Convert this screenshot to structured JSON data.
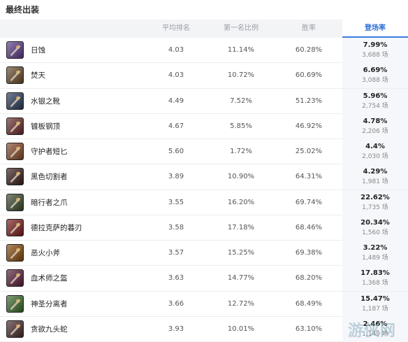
{
  "title": "最终出装",
  "header": {
    "avg_rank": "平均排名",
    "first_ratio": "第一名比例",
    "win_rate": "胜率",
    "pick_rate": "登场率"
  },
  "items": [
    {
      "name": "日蚀",
      "avg_rank": "4.03",
      "first_ratio": "11.14%",
      "win_rate": "60.28%",
      "pick_rate": "7.99%",
      "count": "3,688 场",
      "icon": "eclipse-icon",
      "color": "#5a3a8a"
    },
    {
      "name": "焚天",
      "avg_rank": "4.03",
      "first_ratio": "10.72%",
      "win_rate": "60.69%",
      "pick_rate": "6.69%",
      "count": "3,088 场",
      "icon": "sunfire-blade-icon",
      "color": "#6a4a2a"
    },
    {
      "name": "水银之靴",
      "avg_rank": "4.49",
      "first_ratio": "7.52%",
      "win_rate": "51.23%",
      "pick_rate": "5.96%",
      "count": "2,754 场",
      "icon": "mercury-boots-icon",
      "color": "#2a3a5a"
    },
    {
      "name": "镀板钢顶",
      "avg_rank": "4.67",
      "first_ratio": "5.85%",
      "win_rate": "46.92%",
      "pick_rate": "4.78%",
      "count": "2,206 场",
      "icon": "plated-steelcaps-icon",
      "color": "#6a2a2a"
    },
    {
      "name": "守护者短匕",
      "avg_rank": "5.60",
      "first_ratio": "1.72%",
      "win_rate": "25.02%",
      "pick_rate": "4.4%",
      "count": "2,030 场",
      "icon": "guardian-dagger-icon",
      "color": "#8a4a2a"
    },
    {
      "name": "黑色切割者",
      "avg_rank": "3.89",
      "first_ratio": "10.90%",
      "win_rate": "64.31%",
      "pick_rate": "4.29%",
      "count": "1,981 场",
      "icon": "black-cleaver-icon",
      "color": "#3a1a1a"
    },
    {
      "name": "暗行者之爪",
      "avg_rank": "3.55",
      "first_ratio": "16.20%",
      "win_rate": "69.74%",
      "pick_rate": "22.62%",
      "count": "1,735 场",
      "icon": "prowlers-claw-icon",
      "color": "#3a4a2a"
    },
    {
      "name": "德拉克萨的暮刃",
      "avg_rank": "3.58",
      "first_ratio": "17.18%",
      "win_rate": "68.46%",
      "pick_rate": "20.34%",
      "count": "1,560 场",
      "icon": "duskblade-icon",
      "color": "#7a1a1a"
    },
    {
      "name": "恶火小斧",
      "avg_rank": "3.57",
      "first_ratio": "15.25%",
      "win_rate": "69.38%",
      "pick_rate": "3.22%",
      "count": "1,489 场",
      "icon": "hellfire-hatchet-icon",
      "color": "#8a4a0a"
    },
    {
      "name": "血术师之盔",
      "avg_rank": "3.63",
      "first_ratio": "14.77%",
      "win_rate": "68.20%",
      "pick_rate": "17.83%",
      "count": "1,368 场",
      "icon": "blood-helm-icon",
      "color": "#5a1a3a"
    },
    {
      "name": "神圣分离者",
      "avg_rank": "3.66",
      "first_ratio": "12.72%",
      "win_rate": "68.49%",
      "pick_rate": "15.47%",
      "count": "1,187 场",
      "icon": "divine-sunderer-icon",
      "color": "#3a6a2a"
    },
    {
      "name": "贪欲九头蛇",
      "avg_rank": "3.93",
      "first_ratio": "10.01%",
      "win_rate": "63.10%",
      "pick_rate": "2.46%",
      "count": "1,149 场",
      "icon": "ravenous-hydra-icon",
      "color": "#4a2a2a"
    }
  ]
}
